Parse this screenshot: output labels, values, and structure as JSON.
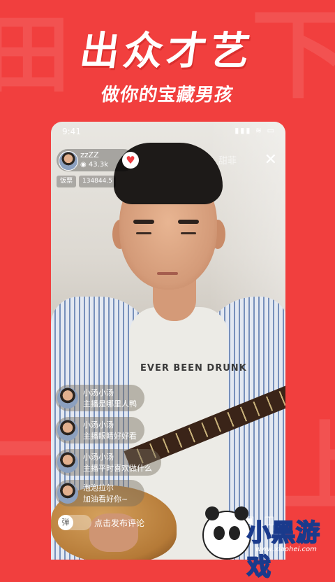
{
  "promo": {
    "headline": "出众才艺",
    "subline": "做你的宝藏男孩"
  },
  "status_bar": {
    "time": "9:41",
    "icons": "▮▮▮ ≋ ▭"
  },
  "host": {
    "name": "zzZZ",
    "views": "43.3k",
    "follow_icon": "heart-icon"
  },
  "top_right": {
    "tag": "甜菲",
    "close_label": "✕"
  },
  "coins": {
    "label": "饭票",
    "value": "134844.5"
  },
  "comments": [
    {
      "user": "小汤小汤",
      "text": "主播是哪里人鸭"
    },
    {
      "user": "小汤小汤",
      "text": "主播眼睛好好看"
    },
    {
      "user": "小汤小汤",
      "text": "主播平时喜欢做什么"
    },
    {
      "user": "泡泡拉尔",
      "text": "加油看好你~"
    }
  ],
  "bottom_bar": {
    "danmu_label": "弹",
    "comment_placeholder": "点击发布评论",
    "icons": "◎ ▣ ◫"
  },
  "shirt_print": "EVER BEEN DRUNK",
  "site_logo": {
    "main": "小黑游戏",
    "sub": "www.xiaohei.com"
  },
  "colors": {
    "background": "#f13f3e",
    "accent_red": "#ef3b3f"
  }
}
